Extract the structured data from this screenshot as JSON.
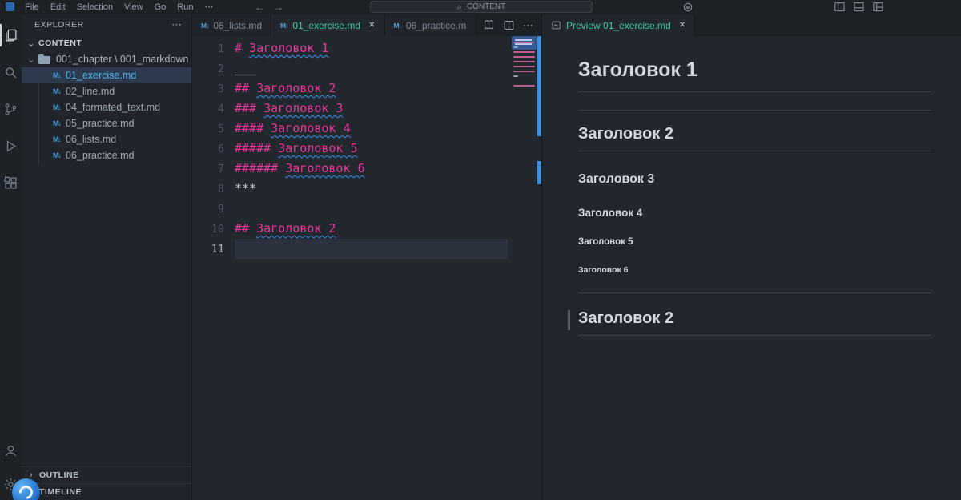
{
  "icons": {
    "close": "✕",
    "more": "⋯",
    "chevron_down": "⌄",
    "chevron_right": "›",
    "back": "←",
    "forward": "→",
    "search": "⌕",
    "markdown": "M↓"
  },
  "title_bar": {
    "app_menus": [
      "File",
      "Edit",
      "Selection",
      "View",
      "Go",
      "Run",
      "⋯"
    ],
    "command_center": "CONTENT"
  },
  "activity_bar": {
    "top": [
      {
        "id": "explorer",
        "active": true
      },
      {
        "id": "search",
        "active": false
      },
      {
        "id": "source-control",
        "active": false
      },
      {
        "id": "run-debug",
        "active": false
      },
      {
        "id": "extensions",
        "active": false
      }
    ],
    "bottom": [
      {
        "id": "accounts"
      },
      {
        "id": "settings"
      }
    ]
  },
  "sidebar": {
    "title": "EXPLORER",
    "section": "CONTENT",
    "folder": "001_chapter \\ 001_markdown",
    "files": [
      {
        "name": "01_exercise.md",
        "selected": true
      },
      {
        "name": "02_line.md",
        "selected": false
      },
      {
        "name": "04_formated_text.md",
        "selected": false
      },
      {
        "name": "05_practice.md",
        "selected": false
      },
      {
        "name": "06_lists.md",
        "selected": false
      },
      {
        "name": "06_practice.md",
        "selected": false
      }
    ],
    "bottom_sections": [
      "OUTLINE",
      "TIMELINE"
    ]
  },
  "editor": {
    "tabs": [
      {
        "label": "06_lists.md",
        "active": false,
        "close": false
      },
      {
        "label": "01_exercise.md",
        "active": true,
        "close": true
      },
      {
        "label": "06_practice.m",
        "active": false,
        "close": false
      }
    ],
    "lines": [
      {
        "n": 1,
        "text": "# Заголовок 1",
        "kind": "heading"
      },
      {
        "n": 2,
        "text": "___",
        "kind": "plain"
      },
      {
        "n": 3,
        "text": "## Заголовок 2",
        "kind": "heading"
      },
      {
        "n": 4,
        "text": "### Заголовок 3",
        "kind": "heading"
      },
      {
        "n": 5,
        "text": "#### Заголовок 4",
        "kind": "heading"
      },
      {
        "n": 6,
        "text": "##### Заголовок 5",
        "kind": "heading"
      },
      {
        "n": 7,
        "text": "###### Заголовок 6",
        "kind": "heading"
      },
      {
        "n": 8,
        "text": "***",
        "kind": "plain"
      },
      {
        "n": 9,
        "text": "",
        "kind": "plain"
      },
      {
        "n": 10,
        "text": "## Заголовок 2",
        "kind": "heading"
      },
      {
        "n": 11,
        "text": "",
        "kind": "active"
      }
    ]
  },
  "preview": {
    "tab_label": "Preview 01_exercise.md",
    "blocks": [
      {
        "type": "h1",
        "text": "Заголовок 1",
        "rule": true
      },
      {
        "type": "hr"
      },
      {
        "type": "h2",
        "text": "Заголовок 2",
        "rule": true
      },
      {
        "type": "h3",
        "text": "Заголовок 3"
      },
      {
        "type": "h4",
        "text": "Заголовок 4"
      },
      {
        "type": "h5",
        "text": "Заголовок 5"
      },
      {
        "type": "h6",
        "text": "Заголовок 6"
      },
      {
        "type": "hr"
      },
      {
        "type": "h2",
        "text": "Заголовок 2",
        "rule": true,
        "selected": true
      }
    ]
  },
  "colors": {
    "heading_token": "#e8389b",
    "squiggle_info": "#3b8eea",
    "active_tab_label": "#3fc9a5",
    "selected_file_label": "#4db8ef",
    "markdown_icon": "#4a9fd8",
    "overview_info_bar": "#3d8fde"
  }
}
